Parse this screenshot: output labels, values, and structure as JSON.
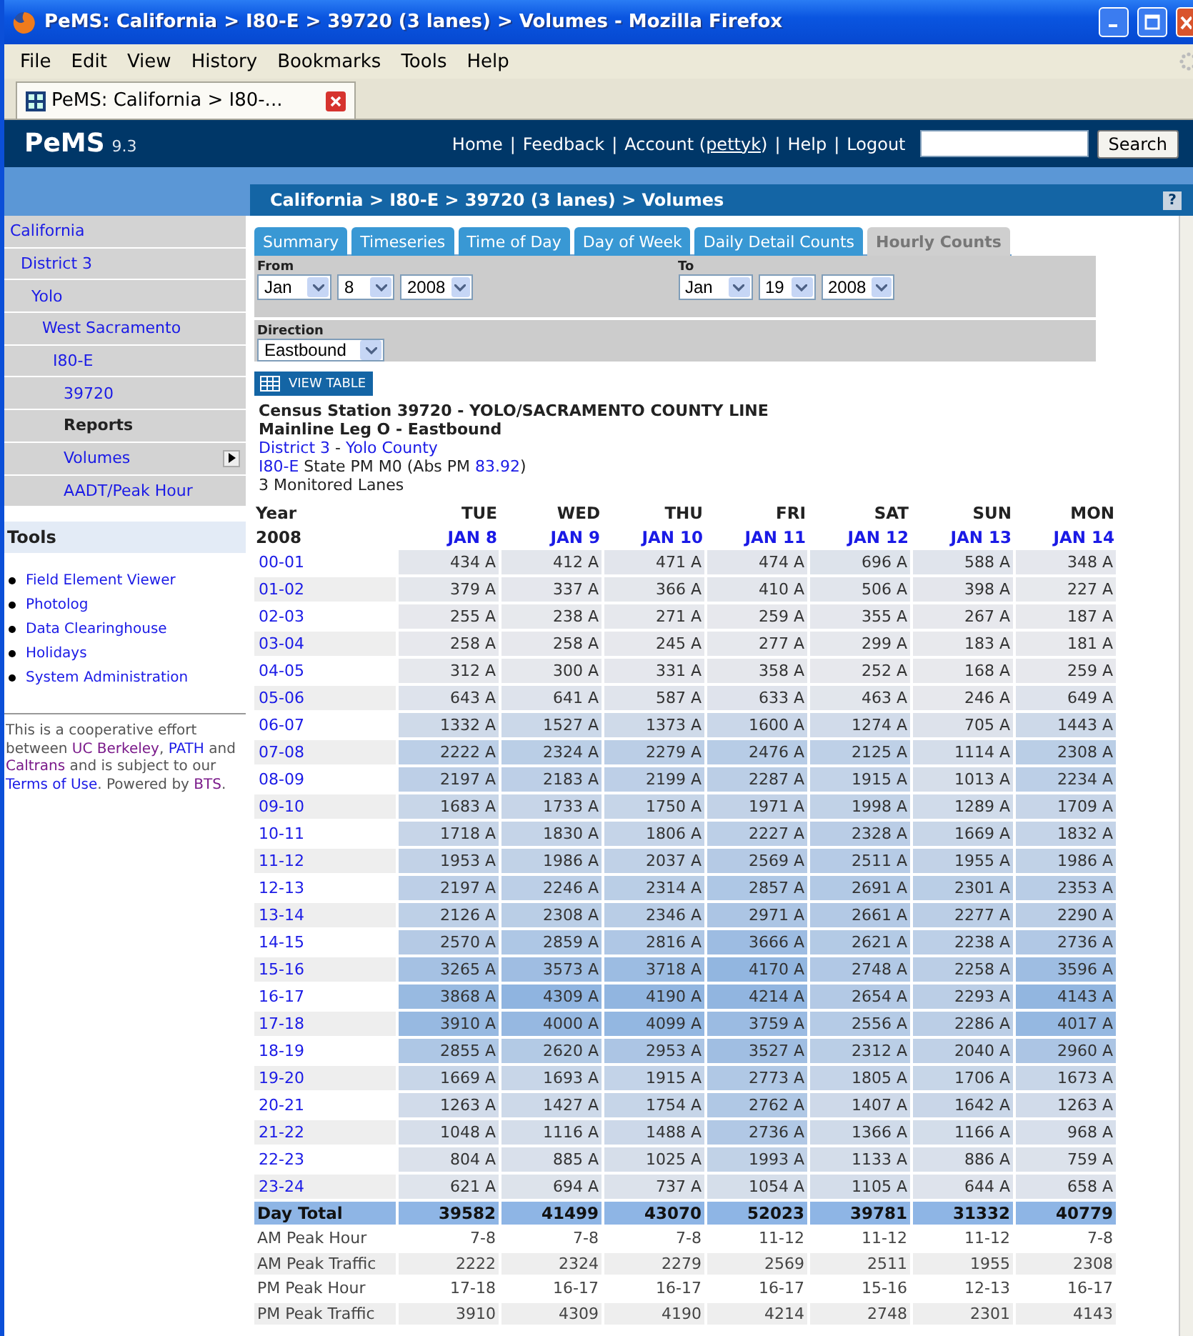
{
  "browser": {
    "title": "PeMS: California > I80-E > 39720 (3 lanes) > Volumes - Mozilla Firefox",
    "menu": [
      "File",
      "Edit",
      "View",
      "History",
      "Bookmarks",
      "Tools",
      "Help"
    ],
    "tabs": [
      {
        "title": "PeMS: California > I80-...",
        "selected": true
      }
    ]
  },
  "site": {
    "logo": "PeMS",
    "version": "9.3",
    "separator": "|",
    "nav": [
      {
        "label": "Home"
      },
      {
        "label": "Feedback"
      },
      {
        "label": "Account (",
        "user": "pettyk",
        "after": ")"
      },
      {
        "label": "Help"
      },
      {
        "label": "Logout"
      }
    ],
    "search_button": "Search"
  },
  "breadcrumb": {
    "text": "California > I80-E > 39720 (3 lanes) > Volumes",
    "help": "?"
  },
  "sidebar": {
    "nav": [
      {
        "label": "California",
        "kind": "link",
        "children": [
          {
            "label": "District 3",
            "kind": "link",
            "children": [
              {
                "label": "Yolo",
                "kind": "link",
                "children": [
                  {
                    "label": "West Sacramento",
                    "kind": "link",
                    "children": [
                      {
                        "label": "I80-E",
                        "kind": "link",
                        "children": [
                          {
                            "label": "39720",
                            "kind": "link",
                            "submenu": false
                          },
                          {
                            "label": "Reports",
                            "kind": "heading",
                            "submenu": false
                          },
                          {
                            "label": "Volumes",
                            "kind": "link",
                            "submenu": true
                          },
                          {
                            "label": "AADT/Peak Hour",
                            "kind": "link",
                            "submenu": false
                          }
                        ]
                      }
                    ]
                  }
                ]
              }
            ]
          }
        ]
      }
    ],
    "tools": {
      "title": "Tools",
      "items": [
        "Field Element Viewer",
        "Photolog",
        "Data Clearinghouse",
        "Holidays",
        "System Administration"
      ]
    },
    "footer": [
      {
        "text": "This is a cooperative effort between ",
        "kind": "text"
      },
      {
        "text": "UC Berkeley",
        "kind": "visited_link"
      },
      {
        "text": ", ",
        "kind": "text"
      },
      {
        "text": "PATH",
        "kind": "link"
      },
      {
        "text": " and ",
        "kind": "text"
      },
      {
        "text": "Caltrans",
        "kind": "visited_link"
      },
      {
        "text": " and is subject to our ",
        "kind": "text"
      },
      {
        "text": "Terms of Use",
        "kind": "link"
      },
      {
        "text": ". Powered by ",
        "kind": "text"
      },
      {
        "text": "BTS",
        "kind": "visited_link"
      },
      {
        "text": ".",
        "kind": "text"
      }
    ]
  },
  "tabs": [
    {
      "label": "Summary",
      "selected": false
    },
    {
      "label": "Timeseries",
      "selected": false
    },
    {
      "label": "Time of Day",
      "selected": false
    },
    {
      "label": "Day of Week",
      "selected": false
    },
    {
      "label": "Daily Detail Counts",
      "selected": false
    },
    {
      "label": "Hourly Counts",
      "selected": true
    }
  ],
  "filters": {
    "from": {
      "label": "From",
      "month": "Jan",
      "day": "8",
      "year": "2008"
    },
    "to": {
      "label": "To",
      "month": "Jan",
      "day": "19",
      "year": "2008"
    },
    "direction": {
      "label": "Direction",
      "value": "Eastbound"
    }
  },
  "view_table": "VIEW TABLE",
  "station": [
    {
      "bold": true,
      "parts": [
        {
          "text": "Census Station 39720 - YOLO/SACRAMENTO COUNTY LINE",
          "kind": "text"
        }
      ]
    },
    {
      "bold": true,
      "parts": [
        {
          "text": "Mainline Leg O - Eastbound",
          "kind": "text"
        }
      ]
    },
    {
      "bold": false,
      "parts": [
        {
          "text": "District 3",
          "kind": "link"
        },
        {
          "text": " - ",
          "kind": "text"
        },
        {
          "text": "Yolo County",
          "kind": "link"
        }
      ]
    },
    {
      "bold": false,
      "parts": [
        {
          "text": "I80-E",
          "kind": "link"
        },
        {
          "text": " State PM M0 (Abs PM ",
          "kind": "text"
        },
        {
          "text": "83.92",
          "kind": "link"
        },
        {
          "text": ")",
          "kind": "text"
        }
      ]
    },
    {
      "bold": false,
      "parts": [
        {
          "text": "3 Monitored Lanes",
          "kind": "text"
        }
      ]
    }
  ],
  "table": {
    "year_label": "Year",
    "year": "2008",
    "columns": [
      {
        "day": "TUE",
        "date": "JAN 8"
      },
      {
        "day": "WED",
        "date": "JAN 9"
      },
      {
        "day": "THU",
        "date": "JAN 10"
      },
      {
        "day": "FRI",
        "date": "JAN 11"
      },
      {
        "day": "SAT",
        "date": "JAN 12"
      },
      {
        "day": "SUN",
        "date": "JAN 13"
      },
      {
        "day": "MON",
        "date": "JAN 14"
      }
    ],
    "rows": [
      {
        "hour": "00-01",
        "values": [
          "434 A",
          "412 A",
          "471 A",
          "474 A",
          "696 A",
          "588 A",
          "348 A"
        ]
      },
      {
        "hour": "01-02",
        "values": [
          "379 A",
          "337 A",
          "366 A",
          "410 A",
          "506 A",
          "398 A",
          "227 A"
        ]
      },
      {
        "hour": "02-03",
        "values": [
          "255 A",
          "238 A",
          "271 A",
          "259 A",
          "355 A",
          "267 A",
          "187 A"
        ]
      },
      {
        "hour": "03-04",
        "values": [
          "258 A",
          "258 A",
          "245 A",
          "277 A",
          "299 A",
          "183 A",
          "181 A"
        ]
      },
      {
        "hour": "04-05",
        "values": [
          "312 A",
          "300 A",
          "331 A",
          "358 A",
          "252 A",
          "168 A",
          "259 A"
        ]
      },
      {
        "hour": "05-06",
        "values": [
          "643 A",
          "641 A",
          "587 A",
          "633 A",
          "463 A",
          "246 A",
          "649 A"
        ]
      },
      {
        "hour": "06-07",
        "values": [
          "1332 A",
          "1527 A",
          "1373 A",
          "1600 A",
          "1274 A",
          "705 A",
          "1443 A"
        ]
      },
      {
        "hour": "07-08",
        "values": [
          "2222 A",
          "2324 A",
          "2279 A",
          "2476 A",
          "2125 A",
          "1114 A",
          "2308 A"
        ]
      },
      {
        "hour": "08-09",
        "values": [
          "2197 A",
          "2183 A",
          "2199 A",
          "2287 A",
          "1915 A",
          "1013 A",
          "2234 A"
        ]
      },
      {
        "hour": "09-10",
        "values": [
          "1683 A",
          "1733 A",
          "1750 A",
          "1971 A",
          "1998 A",
          "1289 A",
          "1709 A"
        ]
      },
      {
        "hour": "10-11",
        "values": [
          "1718 A",
          "1830 A",
          "1806 A",
          "2227 A",
          "2328 A",
          "1669 A",
          "1832 A"
        ]
      },
      {
        "hour": "11-12",
        "values": [
          "1953 A",
          "1986 A",
          "2037 A",
          "2569 A",
          "2511 A",
          "1955 A",
          "1986 A"
        ]
      },
      {
        "hour": "12-13",
        "values": [
          "2197 A",
          "2246 A",
          "2314 A",
          "2857 A",
          "2691 A",
          "2301 A",
          "2353 A"
        ]
      },
      {
        "hour": "13-14",
        "values": [
          "2126 A",
          "2308 A",
          "2346 A",
          "2971 A",
          "2661 A",
          "2277 A",
          "2290 A"
        ]
      },
      {
        "hour": "14-15",
        "values": [
          "2570 A",
          "2859 A",
          "2816 A",
          "3666 A",
          "2621 A",
          "2238 A",
          "2736 A"
        ]
      },
      {
        "hour": "15-16",
        "values": [
          "3265 A",
          "3573 A",
          "3718 A",
          "4170 A",
          "2748 A",
          "2258 A",
          "3596 A"
        ]
      },
      {
        "hour": "16-17",
        "values": [
          "3868 A",
          "4309 A",
          "4190 A",
          "4214 A",
          "2654 A",
          "2293 A",
          "4143 A"
        ]
      },
      {
        "hour": "17-18",
        "values": [
          "3910 A",
          "4000 A",
          "4099 A",
          "3759 A",
          "2556 A",
          "2286 A",
          "4017 A"
        ]
      },
      {
        "hour": "18-19",
        "values": [
          "2855 A",
          "2620 A",
          "2953 A",
          "3527 A",
          "2312 A",
          "2040 A",
          "2960 A"
        ]
      },
      {
        "hour": "19-20",
        "values": [
          "1669 A",
          "1693 A",
          "1915 A",
          "2773 A",
          "1805 A",
          "1706 A",
          "1673 A"
        ]
      },
      {
        "hour": "20-21",
        "values": [
          "1263 A",
          "1427 A",
          "1754 A",
          "2762 A",
          "1407 A",
          "1642 A",
          "1263 A"
        ]
      },
      {
        "hour": "21-22",
        "values": [
          "1048 A",
          "1116 A",
          "1488 A",
          "2736 A",
          "1366 A",
          "1166 A",
          "968 A"
        ]
      },
      {
        "hour": "22-23",
        "values": [
          "804 A",
          "885 A",
          "1025 A",
          "1993 A",
          "1133 A",
          "886 A",
          "759 A"
        ]
      },
      {
        "hour": "23-24",
        "values": [
          "621 A",
          "694 A",
          "737 A",
          "1054 A",
          "1105 A",
          "644 A",
          "658 A"
        ]
      }
    ],
    "total": {
      "label": "Day Total",
      "values": [
        "39582",
        "41499",
        "43070",
        "52023",
        "39781",
        "31332",
        "40779"
      ]
    },
    "peaks": [
      {
        "label": "AM Peak Hour",
        "values": [
          "7-8",
          "7-8",
          "7-8",
          "11-12",
          "11-12",
          "11-12",
          "7-8"
        ]
      },
      {
        "label": "AM Peak Traffic",
        "values": [
          "2222",
          "2324",
          "2279",
          "2569",
          "2511",
          "1955",
          "2308"
        ]
      },
      {
        "label": "PM Peak Hour",
        "values": [
          "17-18",
          "16-17",
          "16-17",
          "16-17",
          "15-16",
          "12-13",
          "16-17"
        ]
      },
      {
        "label": "PM Peak Traffic",
        "values": [
          "3910",
          "4309",
          "4190",
          "4214",
          "2748",
          "2301",
          "4143"
        ]
      }
    ]
  }
}
